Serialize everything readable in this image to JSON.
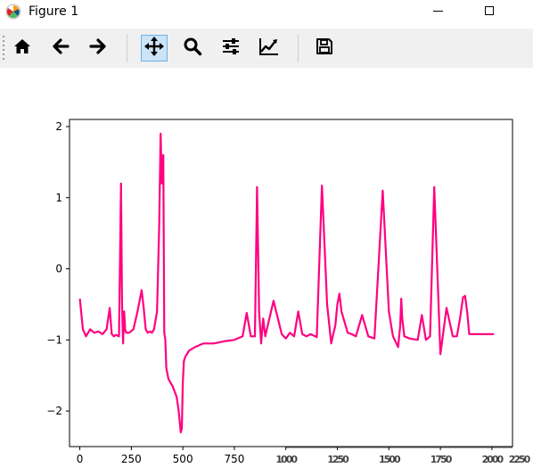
{
  "window": {
    "title": "Figure 1",
    "icon": "matplotlib-icon"
  },
  "toolbar": {
    "buttons": [
      {
        "name": "home",
        "icon": "home-icon"
      },
      {
        "name": "back",
        "icon": "arrow-left-icon"
      },
      {
        "name": "forward",
        "icon": "arrow-right-icon"
      },
      {
        "name": "pan",
        "icon": "move-icon",
        "active": true
      },
      {
        "name": "zoom",
        "icon": "magnifier-icon"
      },
      {
        "name": "configure-subplots",
        "icon": "sliders-icon"
      },
      {
        "name": "edit-axes",
        "icon": "line-chart-icon"
      },
      {
        "name": "save",
        "icon": "floppy-disk-icon"
      }
    ],
    "active_color": "#cce4f7"
  },
  "chart_data": {
    "type": "line",
    "title": "",
    "xlabel": "",
    "ylabel": "",
    "xlim": [
      -50,
      2100
    ],
    "ylim": [
      -2.5,
      2.1
    ],
    "xticks": [
      "0",
      "250",
      "500",
      "750"
    ],
    "xticks_garbled": [
      "1000",
      "1250",
      "1500",
      "1750",
      "2000",
      "2250"
    ],
    "yticks": [
      "2",
      "1",
      "0",
      "−1",
      "−2"
    ],
    "grid": false,
    "series": [
      {
        "color": "#ff0080",
        "x": [
          0,
          15,
          30,
          50,
          70,
          90,
          110,
          130,
          145,
          155,
          165,
          175,
          190,
          200,
          205,
          210,
          215,
          220,
          225,
          240,
          260,
          280,
          300,
          310,
          320,
          330,
          340,
          350,
          360,
          375,
          385,
          392,
          398,
          405,
          410,
          415,
          420,
          430,
          450,
          470,
          480,
          490,
          495,
          500,
          505,
          510,
          515,
          520,
          530,
          560,
          600,
          650,
          700,
          750,
          790,
          810,
          830,
          850,
          860,
          870,
          880,
          890,
          900,
          940,
          980,
          1000,
          1020,
          1040,
          1060,
          1080,
          1100,
          1120,
          1150,
          1175,
          1200,
          1220,
          1230,
          1240,
          1250,
          1260,
          1270,
          1300,
          1320,
          1340,
          1370,
          1400,
          1430,
          1470,
          1500,
          1520,
          1545,
          1555,
          1560,
          1565,
          1575,
          1600,
          1640,
          1660,
          1680,
          1700,
          1720,
          1750,
          1780,
          1810,
          1830,
          1845,
          1860,
          1870,
          1880,
          1890,
          1900,
          1940,
          1970,
          1990,
          2000,
          2010
        ],
        "y": [
          -0.42,
          -0.85,
          -0.95,
          -0.85,
          -0.9,
          -0.88,
          -0.92,
          -0.85,
          -0.55,
          -0.92,
          -0.95,
          -0.93,
          -0.95,
          1.2,
          -0.5,
          -1.05,
          -0.6,
          -0.85,
          -0.9,
          -0.9,
          -0.85,
          -0.6,
          -0.3,
          -0.55,
          -0.85,
          -0.9,
          -0.88,
          -0.9,
          -0.85,
          -0.6,
          0.6,
          1.9,
          1.2,
          1.6,
          -0.9,
          -1.0,
          -1.4,
          -1.55,
          -1.65,
          -1.8,
          -2.0,
          -2.3,
          -2.25,
          -1.6,
          -1.3,
          -1.25,
          -1.22,
          -1.2,
          -1.15,
          -1.1,
          -1.05,
          -1.05,
          -1.02,
          -1.0,
          -0.95,
          -0.62,
          -0.95,
          -0.95,
          1.15,
          -0.6,
          -1.05,
          -0.7,
          -0.95,
          -0.45,
          -0.92,
          -0.98,
          -0.9,
          -0.95,
          -0.6,
          -0.92,
          -0.95,
          -0.92,
          -0.96,
          1.17,
          -0.5,
          -1.05,
          -0.92,
          -0.8,
          -0.5,
          -0.35,
          -0.6,
          -0.9,
          -0.92,
          -0.95,
          -0.65,
          -0.95,
          -0.98,
          1.1,
          -0.6,
          -0.95,
          -1.1,
          -0.8,
          -0.42,
          -0.7,
          -0.95,
          -0.98,
          -1.0,
          -0.65,
          -1.0,
          -0.95,
          1.15,
          -1.2,
          -0.55,
          -0.95,
          -0.95,
          -0.7,
          -0.4,
          -0.38,
          -0.6,
          -0.92,
          -0.92,
          -0.92,
          -0.92,
          -0.92,
          -0.92,
          -0.92
        ]
      }
    ]
  }
}
